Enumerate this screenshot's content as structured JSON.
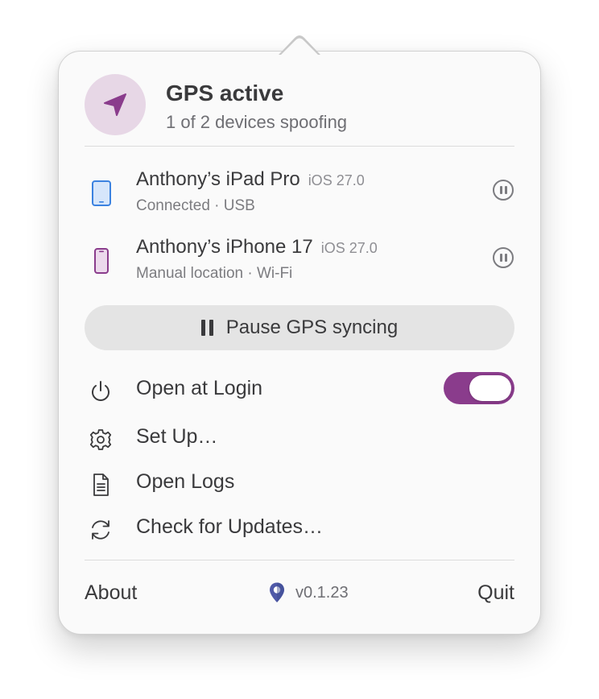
{
  "header": {
    "title": "GPS active",
    "subtitle": "1 of 2 devices spoofing",
    "icon": "location-arrow-icon",
    "accent_color": "#8a3c8c"
  },
  "devices": [
    {
      "name": "Anthony’s iPad Pro",
      "os": "iOS 27.0",
      "status": "Connected · USB",
      "icon": "ipad-icon",
      "icon_color": "#3b82e0",
      "action_icon": "pause-circle-icon"
    },
    {
      "name": "Anthony’s iPhone 17",
      "os": "iOS 27.0",
      "status": "Manual location · Wi-Fi",
      "icon": "iphone-icon",
      "icon_color": "#8a3c8c",
      "action_icon": "pause-circle-icon"
    }
  ],
  "pause_button": {
    "label": "Pause GPS syncing",
    "icon": "pause-icon"
  },
  "menu": [
    {
      "label": "Open at Login",
      "icon": "power-icon",
      "toggle": true,
      "toggle_on": true
    },
    {
      "label": "Set Up…",
      "icon": "gear-icon"
    },
    {
      "label": "Open Logs",
      "icon": "document-icon"
    },
    {
      "label": "Check for Updates…",
      "icon": "refresh-icon"
    }
  ],
  "footer": {
    "about_label": "About",
    "version": "v0.1.23",
    "logo_icon": "map-pin-logo-icon",
    "quit_label": "Quit"
  }
}
